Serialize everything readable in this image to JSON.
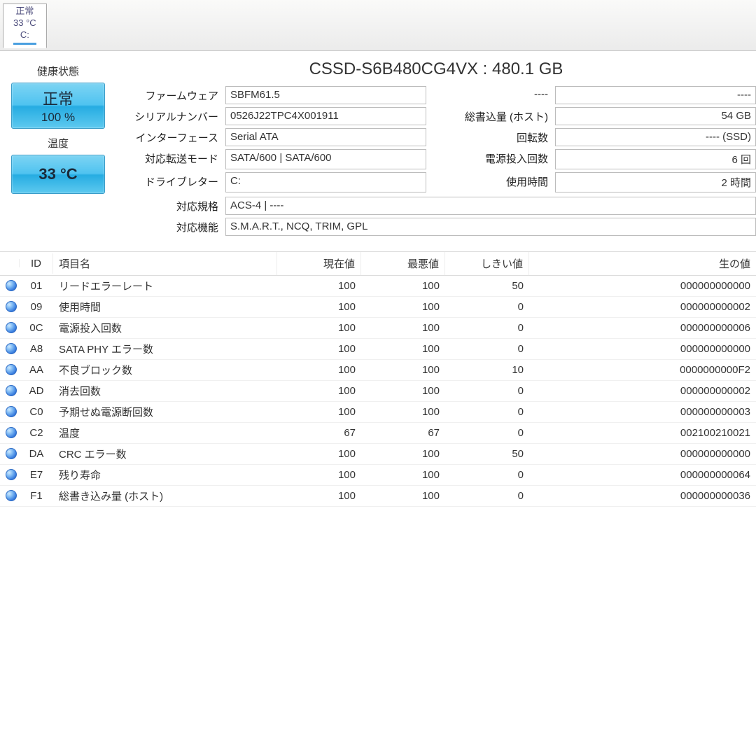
{
  "tab": {
    "status": "正常",
    "temp": "33 °C",
    "drive": "C:"
  },
  "health": {
    "label": "健康状態",
    "status": "正常",
    "percent": "100 %"
  },
  "temperature": {
    "label": "温度",
    "value": "33 °C"
  },
  "title": "CSSD-S6B480CG4VX : 480.1 GB",
  "info": {
    "firmware_label": "ファームウェア",
    "firmware": "SBFM61.5",
    "unknown_label": "----",
    "unknown_value": "----",
    "serial_label": "シリアルナンバー",
    "serial": "0526J22TPC4X001911",
    "total_write_label": "総書込量 (ホスト)",
    "total_write": "54 GB",
    "interface_label": "インターフェース",
    "interface": "Serial ATA",
    "rpm_label": "回転数",
    "rpm": "---- (SSD)",
    "transfer_label": "対応転送モード",
    "transfer": "SATA/600 | SATA/600",
    "power_on_count_label": "電源投入回数",
    "power_on_count": "6 回",
    "drive_letter_label": "ドライブレター",
    "drive_letter": "C:",
    "hours_label": "使用時間",
    "hours": "2 時間",
    "standard_label": "対応規格",
    "standard": "ACS-4 | ----",
    "features_label": "対応機能",
    "features": "S.M.A.R.T., NCQ, TRIM, GPL"
  },
  "smart": {
    "headers": {
      "id": "ID",
      "name": "項目名",
      "current": "現在値",
      "worst": "最悪値",
      "threshold": "しきい値",
      "raw": "生の値"
    },
    "rows": [
      {
        "id": "01",
        "name": "リードエラーレート",
        "cur": "100",
        "worst": "100",
        "thr": "50",
        "raw": "000000000000"
      },
      {
        "id": "09",
        "name": "使用時間",
        "cur": "100",
        "worst": "100",
        "thr": "0",
        "raw": "000000000002"
      },
      {
        "id": "0C",
        "name": "電源投入回数",
        "cur": "100",
        "worst": "100",
        "thr": "0",
        "raw": "000000000006"
      },
      {
        "id": "A8",
        "name": "SATA PHY エラー数",
        "cur": "100",
        "worst": "100",
        "thr": "0",
        "raw": "000000000000"
      },
      {
        "id": "AA",
        "name": "不良ブロック数",
        "cur": "100",
        "worst": "100",
        "thr": "10",
        "raw": "0000000000F2"
      },
      {
        "id": "AD",
        "name": "消去回数",
        "cur": "100",
        "worst": "100",
        "thr": "0",
        "raw": "000000000002"
      },
      {
        "id": "C0",
        "name": "予期せぬ電源断回数",
        "cur": "100",
        "worst": "100",
        "thr": "0",
        "raw": "000000000003"
      },
      {
        "id": "C2",
        "name": "温度",
        "cur": "67",
        "worst": "67",
        "thr": "0",
        "raw": "002100210021"
      },
      {
        "id": "DA",
        "name": "CRC エラー数",
        "cur": "100",
        "worst": "100",
        "thr": "50",
        "raw": "000000000000"
      },
      {
        "id": "E7",
        "name": "残り寿命",
        "cur": "100",
        "worst": "100",
        "thr": "0",
        "raw": "000000000064"
      },
      {
        "id": "F1",
        "name": "総書き込み量 (ホスト)",
        "cur": "100",
        "worst": "100",
        "thr": "0",
        "raw": "000000000036"
      }
    ]
  }
}
